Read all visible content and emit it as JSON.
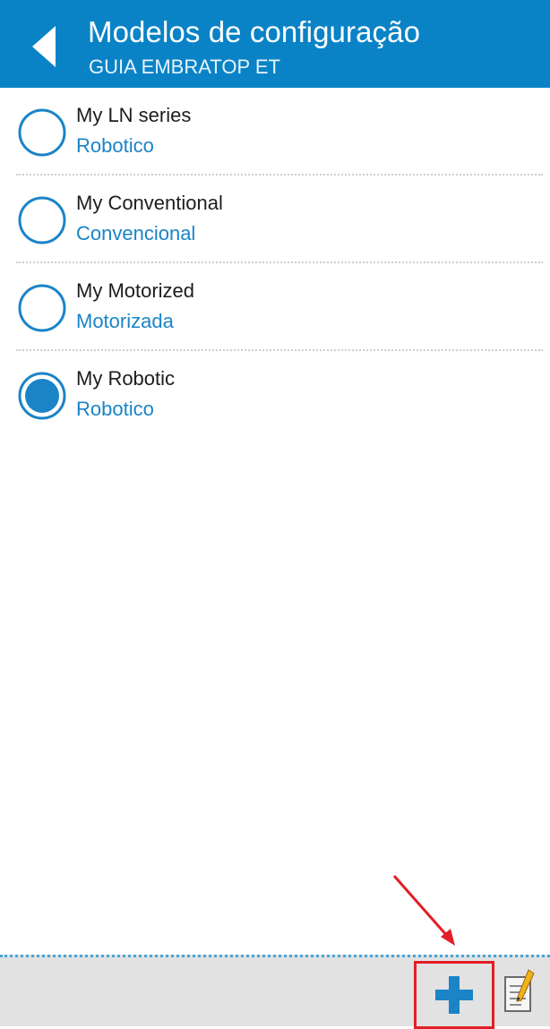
{
  "header": {
    "title": "Modelos de configuração",
    "subtitle": "GUIA EMBRATOP ET",
    "back_icon": "chevron-left-icon",
    "background": "#0a83c6"
  },
  "models": [
    {
      "name": "My LN series",
      "type": "Robotico",
      "selected": false
    },
    {
      "name": "My Conventional",
      "type": "Convencional",
      "selected": false
    },
    {
      "name": "My Motorized",
      "type": "Motorizada",
      "selected": false
    },
    {
      "name": "My Robotic",
      "type": "Robotico",
      "selected": true
    }
  ],
  "toolbar": {
    "add_icon": "plus-icon",
    "edit_icon": "notepad-pencil-icon",
    "highlight_color": "#e21e26"
  },
  "colors": {
    "accent": "#1a84c7",
    "annotation": "#e21e26"
  }
}
